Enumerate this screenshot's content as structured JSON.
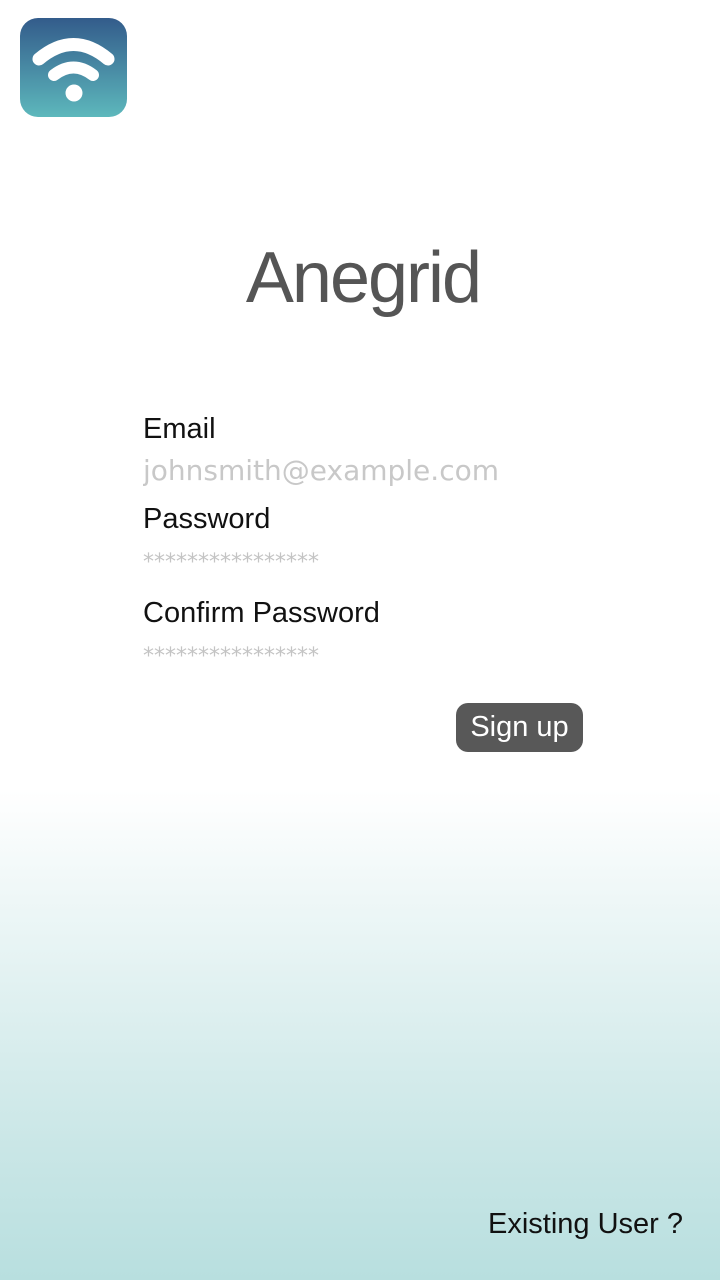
{
  "app": {
    "icon": "wifi-icon",
    "title": "Anegrid"
  },
  "form": {
    "email_label": "Email",
    "email_placeholder": "johnsmith@example.com",
    "password_label": "Password",
    "password_placeholder": "****************",
    "confirm_label": "Confirm Password",
    "confirm_placeholder": "****************"
  },
  "actions": {
    "signup_label": "Sign up",
    "existing_user_label": "Existing User ?"
  },
  "colors": {
    "icon_top": "#335c8b",
    "icon_bottom": "#5db8bc",
    "button_bg": "#585858",
    "background_bottom": "#b8dfdf"
  }
}
